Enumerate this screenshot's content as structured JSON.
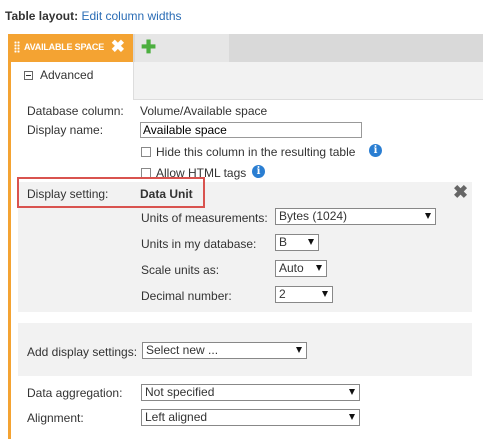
{
  "header": {
    "label": "Table layout:",
    "link": "Edit column widths"
  },
  "tabs": {
    "column_tab": "AVAILABLE SPACE",
    "add_tab_icon": "plus-icon",
    "close_icon": "close-icon"
  },
  "section": {
    "title": "Advanced"
  },
  "fields": {
    "database_column_label": "Database column:",
    "database_column_value": "Volume/Available space",
    "display_name_label": "Display name:",
    "display_name_value": "Available space",
    "hide_column_label": "Hide this column in the resulting table",
    "allow_html_label": "Allow HTML tags"
  },
  "display_setting": {
    "label": "Display setting:",
    "value": "Data Unit",
    "units_label": "Units of measurements:",
    "units_value": "Bytes (1024)",
    "db_units_label": "Units in my database:",
    "db_units_value": "B",
    "scale_label": "Scale units as:",
    "scale_value": "Auto",
    "decimal_label": "Decimal number:",
    "decimal_value": "2"
  },
  "add_settings": {
    "label": "Add display settings:",
    "value": "Select new ..."
  },
  "aggregation": {
    "label": "Data aggregation:",
    "value": "Not specified"
  },
  "alignment": {
    "label": "Alignment:",
    "value": "Left aligned"
  },
  "colors": {
    "accent": "#f4a332",
    "link": "#2a6cb5",
    "highlight": "#d9534f",
    "info": "#2a7ed2"
  }
}
